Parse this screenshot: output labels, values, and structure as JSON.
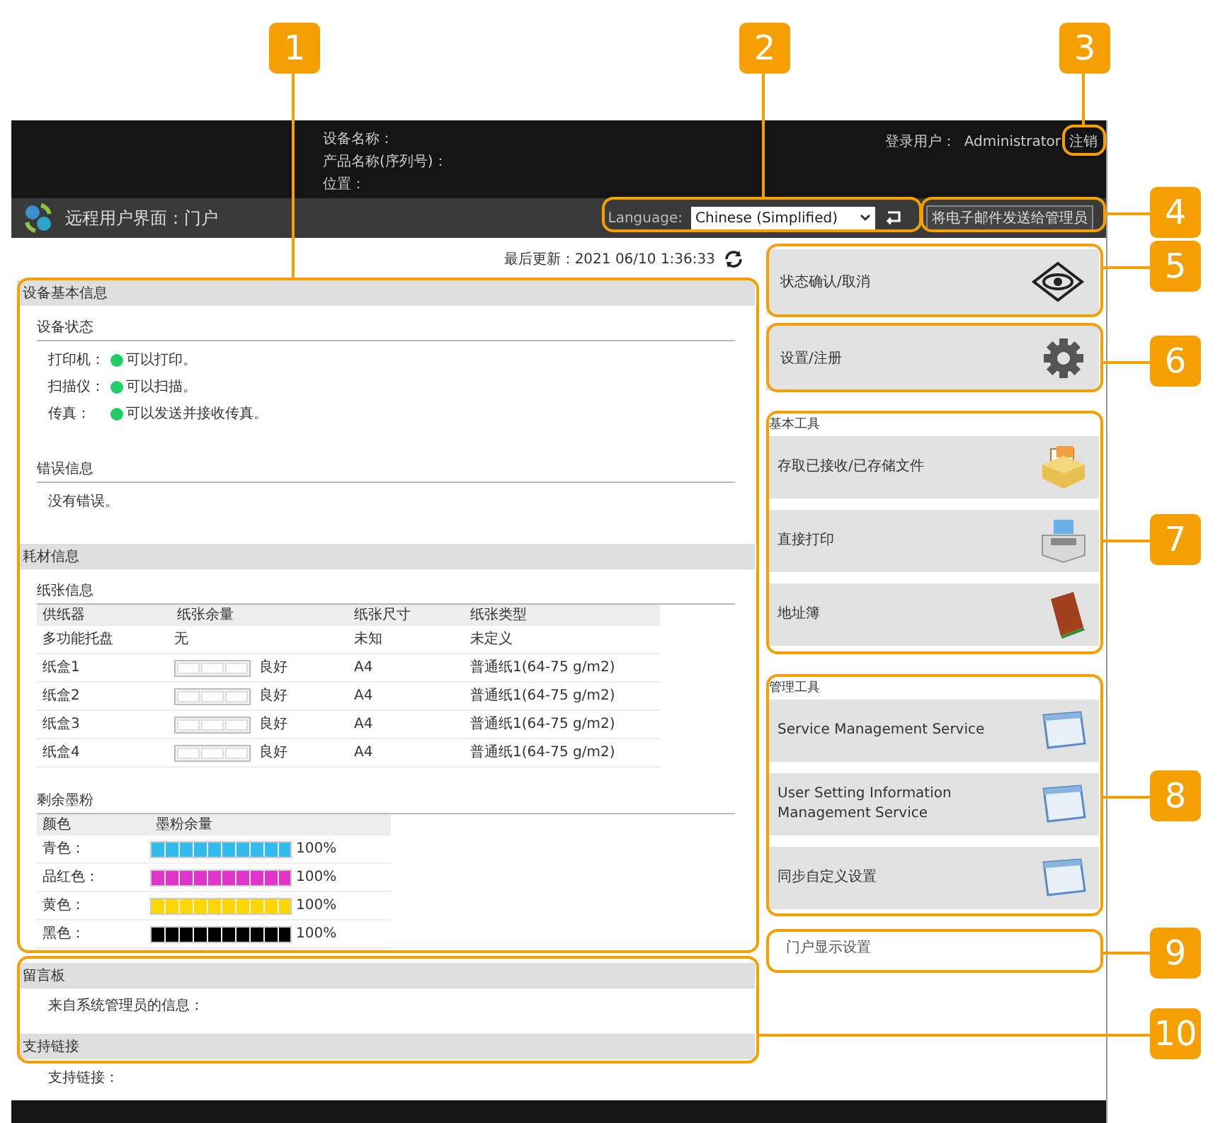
{
  "header": {
    "device_fields": [
      "设备名称：",
      "产品名称(序列号)：",
      "位置："
    ],
    "login_label": "登录用户：",
    "login_user": "Administrator",
    "logout": "注销"
  },
  "title_bar": {
    "title": "远程用户界面：门户",
    "language_label": "Language:",
    "language": "Chinese (Simplified)",
    "mail_button": "将电子邮件发送给管理员"
  },
  "last_updated": "最后更新：2021 06/10 1:36:33",
  "device_info": {
    "title": "设备基本信息",
    "status_title": "设备状态",
    "statuses": [
      {
        "label": "打印机：",
        "text": "可以打印。"
      },
      {
        "label": "扫描仪：",
        "text": "可以扫描。"
      },
      {
        "label": "传真：",
        "text": "可以发送并接收传真。"
      }
    ],
    "error_title": "错误信息",
    "error_text": "没有错误。"
  },
  "consumables": {
    "title": "耗材信息",
    "paper_title": "纸张信息",
    "paper_columns": [
      "供纸器",
      "纸张余量",
      "纸张尺寸",
      "纸张类型"
    ],
    "paper_rows": [
      {
        "source": "多功能托盘",
        "kind": "text",
        "remaining": "无",
        "size": "未知",
        "type": "未定义"
      },
      {
        "source": "纸盒1",
        "kind": "meter",
        "remaining": "良好",
        "size": "A4",
        "type": "普通纸1(64-75 g/m2)"
      },
      {
        "source": "纸盒2",
        "kind": "meter",
        "remaining": "良好",
        "size": "A4",
        "type": "普通纸1(64-75 g/m2)"
      },
      {
        "source": "纸盒3",
        "kind": "meter",
        "remaining": "良好",
        "size": "A4",
        "type": "普通纸1(64-75 g/m2)"
      },
      {
        "source": "纸盒4",
        "kind": "meter",
        "remaining": "良好",
        "size": "A4",
        "type": "普通纸1(64-75 g/m2)"
      }
    ],
    "toner_title": "剩余墨粉",
    "toner_columns": [
      "颜色",
      "墨粉余量"
    ],
    "toners": [
      {
        "name": "青色：",
        "color": "#33bbee",
        "level": 1,
        "reading": "100%"
      },
      {
        "name": "品红色：",
        "color": "#e033cc",
        "level": 1,
        "reading": "100%"
      },
      {
        "name": "黄色：",
        "color": "#ffd700",
        "level": 1,
        "reading": "100%"
      },
      {
        "name": "黑色：",
        "color": "#000000",
        "level": 1,
        "reading": "100%"
      }
    ]
  },
  "message_board": {
    "title": "留言板",
    "text": "来自系统管理员的信息："
  },
  "support": {
    "title": "支持链接",
    "text": "支持链接："
  },
  "side_buttons": [
    {
      "label": "状态确认/取消"
    },
    {
      "label": "设置/注册"
    }
  ],
  "tool_groups": [
    {
      "title": "基本工具",
      "items": [
        {
          "label": "存取已接收/已存储文件"
        },
        {
          "label": "直接打印"
        },
        {
          "label": "地址簿"
        }
      ]
    },
    {
      "title": "管理工具",
      "items": [
        {
          "label": "Service Management Service"
        },
        {
          "label": "User Setting Information Management Service"
        },
        {
          "label": "同步自定义设置"
        }
      ]
    }
  ],
  "portal_settings": "门户显示设置",
  "callouts": [
    {
      "label": "1"
    },
    {
      "label": "2"
    },
    {
      "label": "3"
    },
    {
      "label": "4"
    },
    {
      "label": "5"
    },
    {
      "label": "6"
    },
    {
      "label": "7"
    },
    {
      "label": "8"
    },
    {
      "label": "9"
    },
    {
      "label": "10"
    }
  ]
}
